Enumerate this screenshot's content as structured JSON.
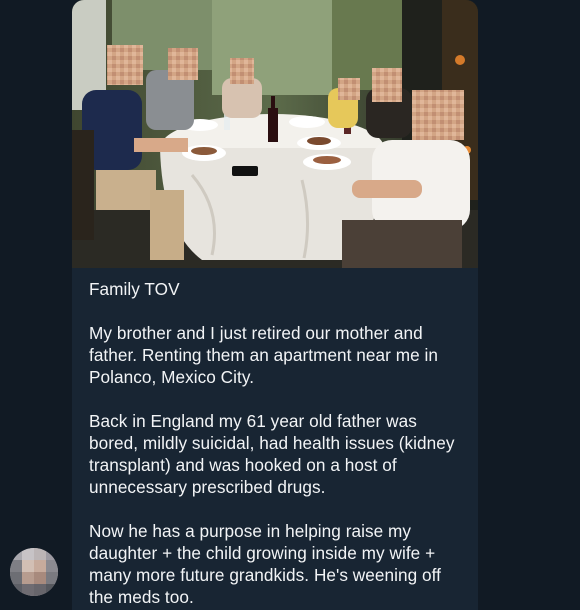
{
  "chat": {
    "message": {
      "title": "Family TOV",
      "paragraphs": [
        "My brother and I just retired our mother and father. Renting them an apartment near me in Polanco, Mexico City.",
        "Back in England my 61 year old father was bored, mildly suicidal, had health issues (kidney transplant) and was hooked on a host of unnecessary prescribed drugs.",
        "Now he has a purpose in helping raise my daughter + the child growing inside my wife + many more future grandkids. He's weening off the meds too."
      ]
    }
  },
  "icons": {
    "avatar": "pixelated-avatar-icon"
  }
}
